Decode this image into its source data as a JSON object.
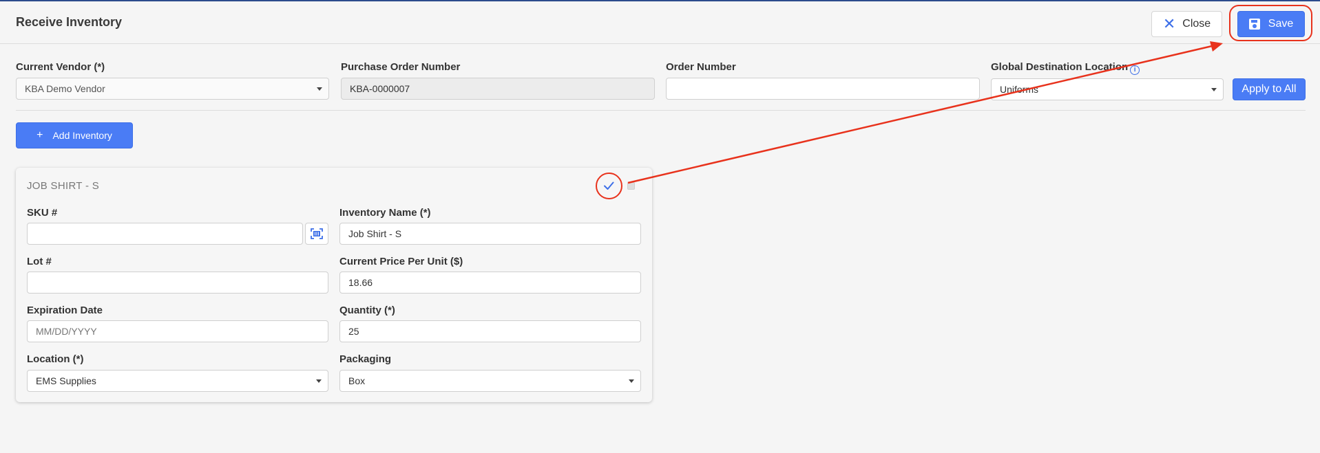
{
  "header": {
    "title": "Receive Inventory",
    "close_label": "Close",
    "save_label": "Save"
  },
  "form": {
    "vendor": {
      "label": "Current Vendor (*)",
      "value": "KBA Demo Vendor"
    },
    "po_number": {
      "label": "Purchase Order Number",
      "value": "KBA-0000007"
    },
    "order_number": {
      "label": "Order Number",
      "value": ""
    },
    "global_location": {
      "label": "Global Destination Location",
      "value": "Uniforms"
    },
    "apply_label": "Apply to All",
    "add_inventory_label": "Add Inventory"
  },
  "card": {
    "title": "JOB SHIRT - S",
    "sku": {
      "label": "SKU #",
      "value": ""
    },
    "inventory_name": {
      "label": "Inventory Name (*)",
      "value": "Job Shirt - S"
    },
    "lot": {
      "label": "Lot #",
      "value": ""
    },
    "price": {
      "label": "Current Price Per Unit ($)",
      "value": "18.66"
    },
    "expiration": {
      "label": "Expiration Date",
      "placeholder": "MM/DD/YYYY"
    },
    "quantity": {
      "label": "Quantity (*)",
      "value": "25"
    },
    "location": {
      "label": "Location (*)",
      "value": "EMS Supplies"
    },
    "packaging": {
      "label": "Packaging",
      "value": "Box"
    }
  },
  "colors": {
    "accent": "#4a7cf5",
    "annotation": "#e8321c"
  },
  "icons": {
    "close": "close-icon",
    "save": "save-icon",
    "info": "info-icon",
    "add": "plus-icon",
    "check": "check-icon",
    "scan": "barcode-scan-icon",
    "dropdown": "chevron-down-icon"
  }
}
